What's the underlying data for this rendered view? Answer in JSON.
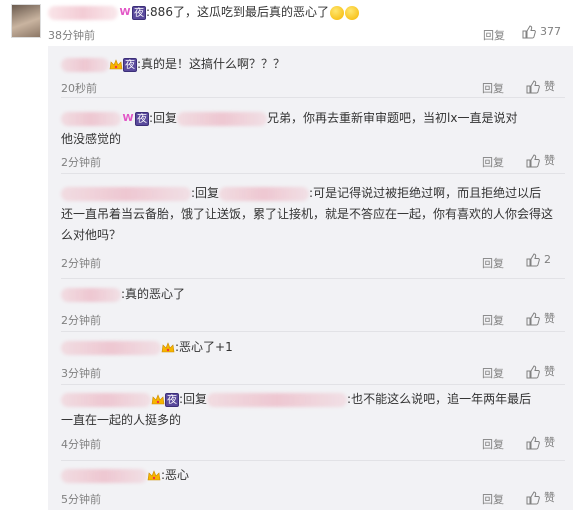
{
  "top_comment": {
    "text": ":886了，这瓜吃到最后真的恶心了",
    "time": "38分钟前",
    "reply_label": "回复",
    "like_count": "377"
  },
  "replies": [
    {
      "text": ":真的是！这搞什么啊？？？",
      "time": "20秒前",
      "reply_label": "回复",
      "like_label": "赞"
    },
    {
      "prefix": ":回复",
      "text_a": "兄弟，你再去重新审审题吧，当初lx一直是说对",
      "text_b": "他没感觉的",
      "time": "2分钟前",
      "reply_label": "回复",
      "like_label": "赞"
    },
    {
      "prefix": ":回复",
      "text_a": ":可是记得说过被拒绝过啊，而且拒绝过以后",
      "text_b": "还一直吊着当云备胎，饿了让送饭，累了让接机，就是不答应在一起，你有喜欢的人你会得这",
      "text_c": "么对他吗？",
      "time": "2分钟前",
      "reply_label": "回复",
      "like_label": "2"
    },
    {
      "text": ":真的恶心了",
      "time": "2分钟前",
      "reply_label": "回复",
      "like_label": "赞"
    },
    {
      "text": ":恶心了+1",
      "time": "3分钟前",
      "reply_label": "回复",
      "like_label": "赞"
    },
    {
      "prefix": ":回复",
      "text_a": ":也不能这么说吧，追一年两年最后",
      "text_b": "一直在一起的人挺多的",
      "time": "4分钟前",
      "reply_label": "回复",
      "like_label": "赞"
    },
    {
      "text": ":恶心",
      "time": "5分钟前",
      "reply_label": "回复",
      "like_label": "赞"
    }
  ],
  "badges": {
    "w": "W",
    "night": "夜"
  },
  "icons": {
    "thumb": "thumbs-up-icon",
    "crown": "crown-badge-icon",
    "emoji": "smile-emoji-icon"
  },
  "colors": {
    "panel_bg": "#f2f2f5",
    "meta_text": "#808080",
    "badge_w": "#e255c6",
    "badge_night": "#5a4a9c"
  }
}
